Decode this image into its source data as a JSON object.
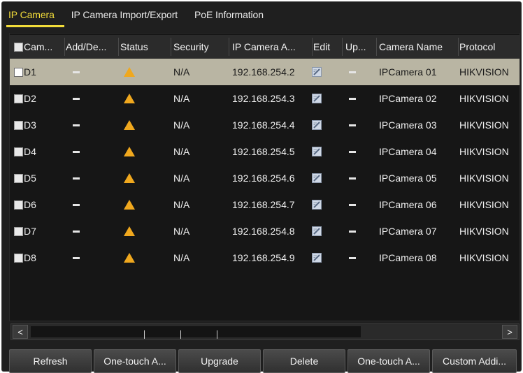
{
  "tabs": [
    {
      "label": "IP Camera",
      "active": true
    },
    {
      "label": "IP Camera Import/Export",
      "active": false
    },
    {
      "label": "PoE Information",
      "active": false
    }
  ],
  "table": {
    "headers": {
      "camera": "Cam...",
      "add_delete": "Add/De...",
      "status": "Status",
      "security": "Security",
      "ip_address": "IP Camera A...",
      "edit": "Edit",
      "upgrade": "Up...",
      "camera_name": "Camera Name",
      "protocol": "Protocol"
    },
    "rows": [
      {
        "camera": "D1",
        "security": "N/A",
        "ip": "192.168.254.2",
        "name": "IPCamera 01",
        "protocol": "HIKVISION"
      },
      {
        "camera": "D2",
        "security": "N/A",
        "ip": "192.168.254.3",
        "name": "IPCamera 02",
        "protocol": "HIKVISION"
      },
      {
        "camera": "D3",
        "security": "N/A",
        "ip": "192.168.254.4",
        "name": "IPCamera 03",
        "protocol": "HIKVISION"
      },
      {
        "camera": "D4",
        "security": "N/A",
        "ip": "192.168.254.5",
        "name": "IPCamera 04",
        "protocol": "HIKVISION"
      },
      {
        "camera": "D5",
        "security": "N/A",
        "ip": "192.168.254.6",
        "name": "IPCamera 05",
        "protocol": "HIKVISION"
      },
      {
        "camera": "D6",
        "security": "N/A",
        "ip": "192.168.254.7",
        "name": "IPCamera 06",
        "protocol": "HIKVISION"
      },
      {
        "camera": "D7",
        "security": "N/A",
        "ip": "192.168.254.8",
        "name": "IPCamera 07",
        "protocol": "HIKVISION"
      },
      {
        "camera": "D8",
        "security": "N/A",
        "ip": "192.168.254.9",
        "name": "IPCamera 08",
        "protocol": "HIKVISION"
      }
    ],
    "status_icon": "warning-triangle-icon",
    "edit_icon": "edit-icon"
  },
  "scrollbar": {
    "left_arrow": "<",
    "right_arrow": ">"
  },
  "buttons": {
    "refresh": "Refresh",
    "one_touch_activate": "One-touch A...",
    "upgrade": "Upgrade",
    "delete": "Delete",
    "one_touch_adding": "One-touch A...",
    "custom_adding": "Custom Addi..."
  },
  "colors": {
    "accent": "#f2dc3a",
    "selected_row": "#b9b5a3",
    "warning": "#f0a81e",
    "background": "#1f1f1f"
  }
}
